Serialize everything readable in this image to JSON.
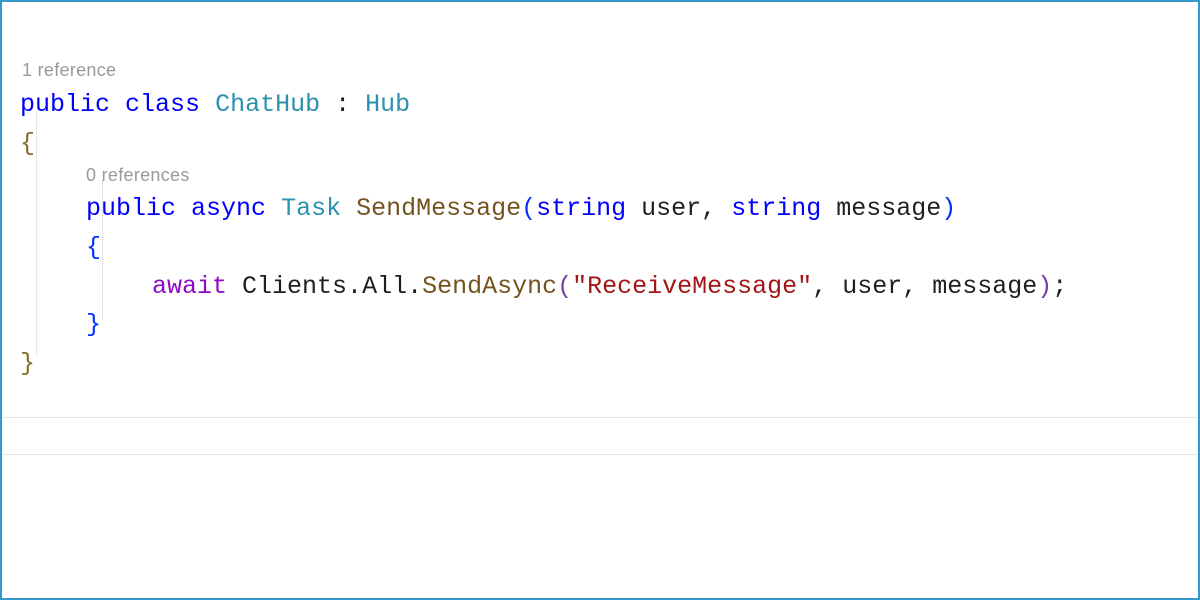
{
  "codelens": {
    "class_refs": "1 reference",
    "method_refs": "0 references"
  },
  "code": {
    "kw_public": "public",
    "kw_class": "class",
    "class_name": "ChatHub",
    "colon": " : ",
    "base_class": "Hub",
    "open_brace_class": "{",
    "kw_public2": "public",
    "kw_async": "async",
    "type_task": "Task",
    "method_name": "SendMessage",
    "open_paren": "(",
    "kw_string1": "string",
    "param_user": " user",
    "comma1": ", ",
    "kw_string2": "string",
    "param_message": " message",
    "close_paren": ")",
    "open_brace_method": "{",
    "kw_await": "await",
    "clients": " Clients",
    "dot1": ".",
    "all": "All",
    "dot2": ".",
    "sendasync": "SendAsync",
    "open_paren2": "(",
    "string_lit": "\"ReceiveMessage\"",
    "comma2": ", ",
    "arg_user": "user",
    "comma3": ", ",
    "arg_message": "message",
    "close_paren2": ")",
    "semicolon": ";",
    "close_brace_method": "}",
    "close_brace_class": "}"
  }
}
